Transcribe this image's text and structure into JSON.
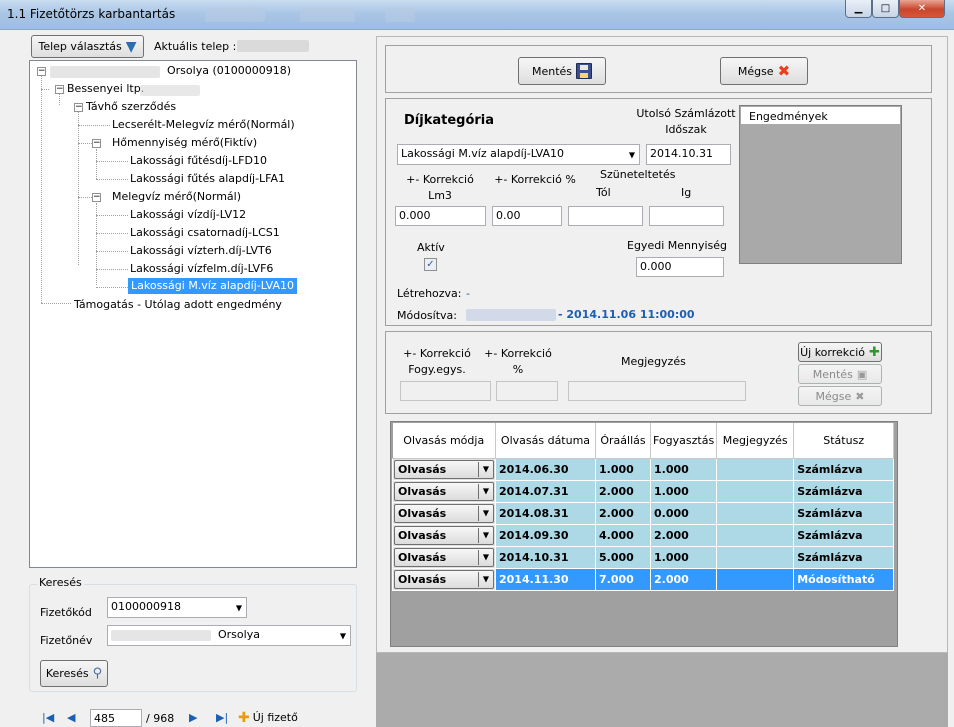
{
  "window": {
    "title": "1.1 Fizetőtörzs karbantartás",
    "min_glyph": "▁",
    "max_glyph": "□",
    "close_glyph": "✕"
  },
  "left": {
    "telep_button": "Telep választás",
    "aktualis_label": "Aktuális telep :",
    "tree": {
      "root": "Orsolya (0100000918)",
      "address": "Bessenyei ltp.",
      "contract": "Távhő szerződés",
      "n1": "Lecserélt-Melegvíz mérő(Normál)",
      "n2": "Hőmennyiség mérő(Fiktív)",
      "n2a": "Lakossági fűtésdíj-LFD10",
      "n2b": "Lakossági fűtés alapdíj-LFA1",
      "n3": "Melegvíz mérő(Normál)",
      "n3a": "Lakossági vízdíj-LV12",
      "n3b": "Lakossági csatornadíj-LCS1",
      "n3c": "Lakossági vízterh.díj-LVT6",
      "n3d": "Lakossági vízfelm.díj-LVF6",
      "n3e": "Lakossági M.víz alapdíj-LVA10",
      "n4": "Támogatás - Utólag adott engedmény"
    },
    "search": {
      "group": "Keresés",
      "code_label": "Fizetőkód",
      "code_value": "0100000918",
      "name_label": "Fizetőnév",
      "name_value": "Orsolya",
      "button": "Keresés"
    },
    "nav": {
      "current": "485",
      "total": "/ 968",
      "new_button": "Új fizető"
    }
  },
  "toolbar": {
    "save": "Mentés",
    "cancel": "Mégse"
  },
  "dij": {
    "title": "Díjkategória",
    "last_period_label": "Utolsó Számlázott Időszak",
    "category_value": "Lakossági M.víz alapdíj-LVA10",
    "last_period_value": "2014.10.31",
    "korr_lm3_label": "+- Korrekció Lm3",
    "korr_pct_label": "+- Korrekció %",
    "szunetel_label": "Szüneteltetés",
    "tol_label": "Tól",
    "ig_label": "Ig",
    "korr_lm3_value": "0.000",
    "korr_pct_value": "0.00",
    "aktiv_label": "Aktív",
    "aktiv_checked": "✓",
    "egyedi_label": "Egyedi Mennyiség",
    "egyedi_value": "0.000",
    "letrehozva_label": "Létrehozva:",
    "letrehozva_value": "-",
    "modositva_label": "Módosítva:",
    "modositva_value": "- 2014.11.06 11:00:00",
    "engedmenyek_header": "Engedmények"
  },
  "korrekcio": {
    "fogy_label": "+- Korrekció Fogy.egys.",
    "pct_label": "+- Korrekció %",
    "megj_label": "Megjegyzés",
    "new_button": "Új korrekció",
    "save_button": "Mentés",
    "cancel_button": "Mégse"
  },
  "grid": {
    "headers": [
      "Olvasás módja",
      "Olvasás dátuma",
      "Óraállás",
      "Fogyasztás",
      "Megjegyzés",
      "Státusz"
    ],
    "rows": [
      {
        "mode": "Olvasás",
        "date": "2014.06.30",
        "ora": "1.000",
        "fogy": "1.000",
        "megj": "",
        "status": "Számlázva"
      },
      {
        "mode": "Olvasás",
        "date": "2014.07.31",
        "ora": "2.000",
        "fogy": "1.000",
        "megj": "",
        "status": "Számlázva"
      },
      {
        "mode": "Olvasás",
        "date": "2014.08.31",
        "ora": "2.000",
        "fogy": "0.000",
        "megj": "",
        "status": "Számlázva"
      },
      {
        "mode": "Olvasás",
        "date": "2014.09.30",
        "ora": "4.000",
        "fogy": "2.000",
        "megj": "",
        "status": "Számlázva"
      },
      {
        "mode": "Olvasás",
        "date": "2014.10.31",
        "ora": "5.000",
        "fogy": "1.000",
        "megj": "",
        "status": "Számlázva"
      },
      {
        "mode": "Olvasás",
        "date": "2014.11.30",
        "ora": "7.000",
        "fogy": "2.000",
        "megj": "",
        "status": "Módosítható"
      }
    ]
  },
  "colors": {
    "selection": "#3399ff",
    "row_bg": "#add8e6",
    "link_blue": "#1a5fb4"
  }
}
